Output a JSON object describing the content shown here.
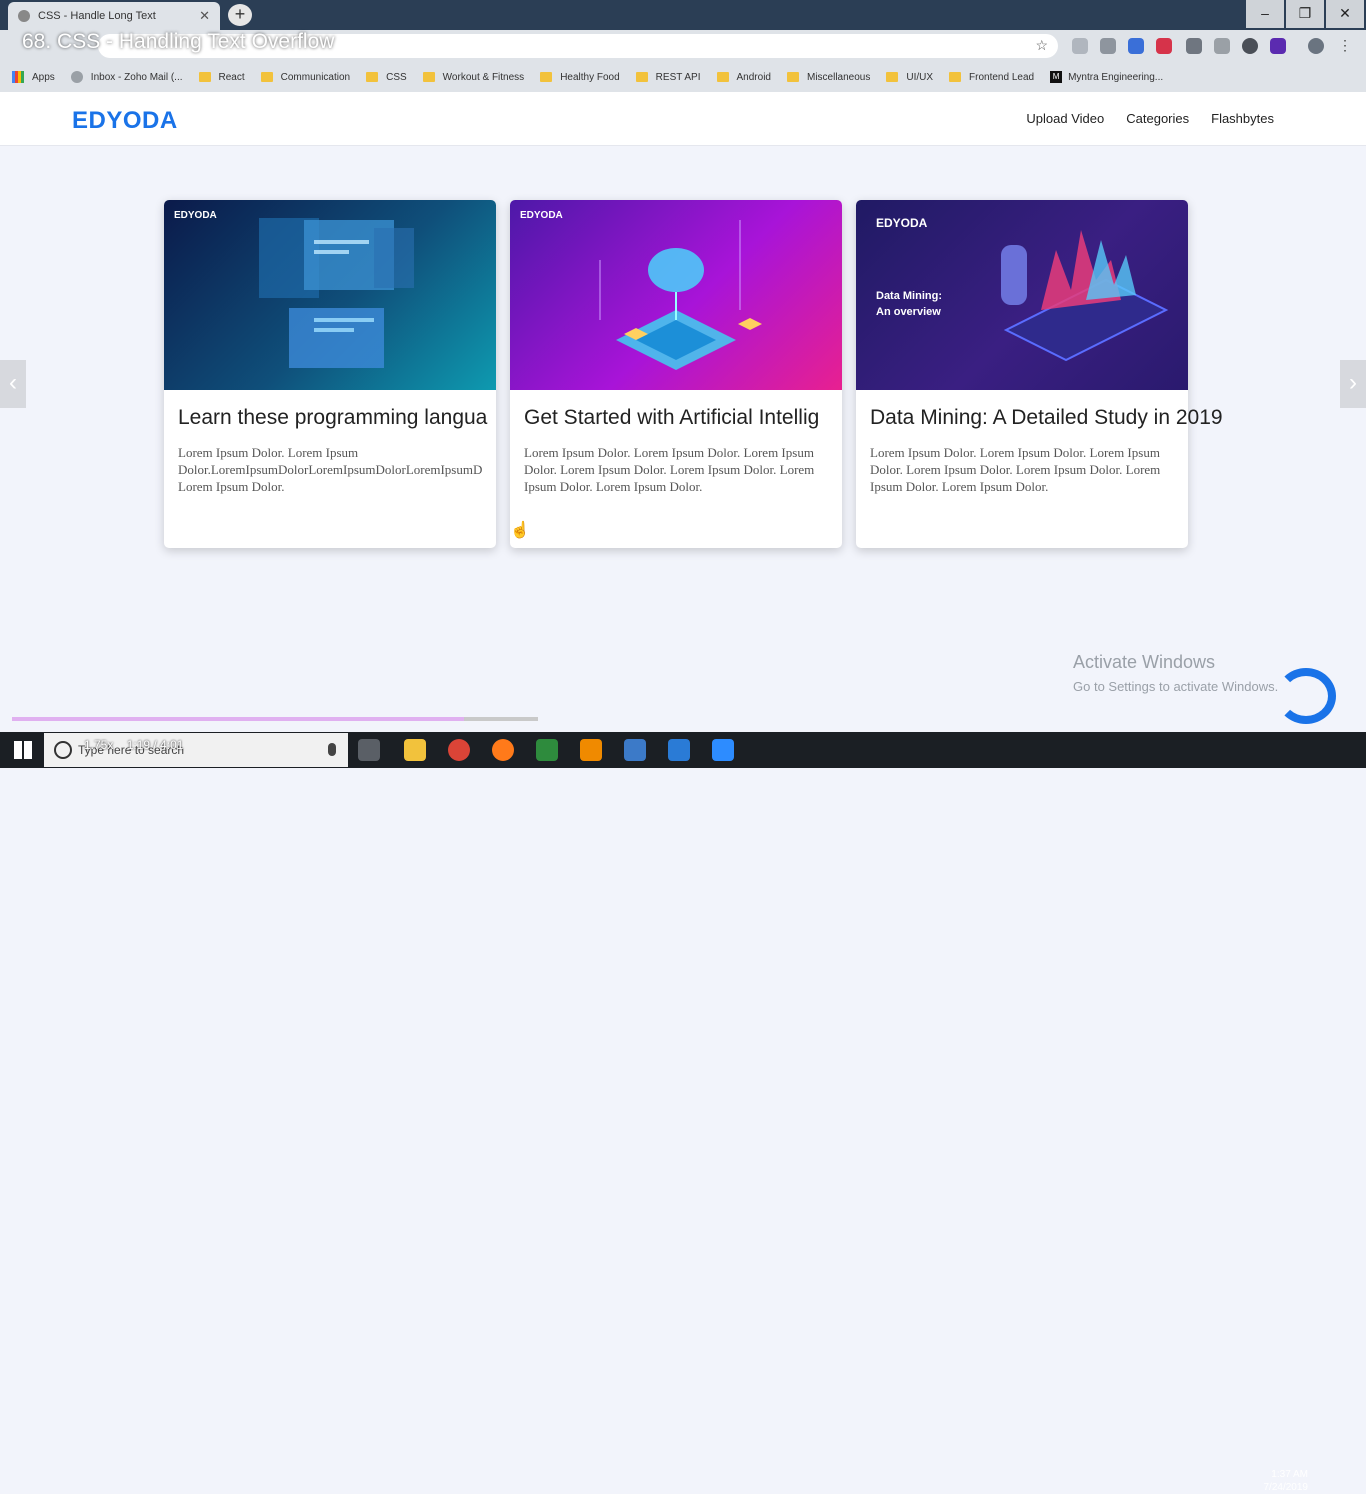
{
  "browser": {
    "tab_title": "CSS - Handle Long Text",
    "overlay_title": "68. CSS - Handling Text Overflow",
    "bookmarks": [
      "Apps",
      "Inbox - Zoho Mail (...",
      "React",
      "Communication",
      "CSS",
      "Workout & Fitness",
      "Healthy Food",
      "REST API",
      "Android",
      "Miscellaneous",
      "UI/UX",
      "Frontend Lead",
      "Myntra Engineering..."
    ]
  },
  "site": {
    "logo": "EDYODA",
    "nav": [
      "Upload Video",
      "Categories",
      "Flashbytes"
    ]
  },
  "cards": [
    {
      "brand": "EDYODA",
      "title": "Learn these programming langua",
      "body": "Lorem Ipsum Dolor. Lorem Ipsum Dolor.LoremIpsumDolorLoremIpsumDolorLoremIpsumD Lorem Ipsum Dolor."
    },
    {
      "brand": "EDYODA",
      "title": "Get Started with Artificial Intellig",
      "body": "Lorem Ipsum Dolor. Lorem Ipsum Dolor. Lorem Ipsum Dolor. Lorem Ipsum Dolor. Lorem Ipsum Dolor. Lorem Ipsum Dolor. Lorem Ipsum Dolor."
    },
    {
      "brand": "EDYODA",
      "thumb_caption_1": "Data Mining:",
      "thumb_caption_2": "An overview",
      "title": "Data Mining: A Detailed Study in 2019",
      "body": "Lorem Ipsum Dolor. Lorem Ipsum Dolor. Lorem Ipsum Dolor. Lorem Ipsum Dolor. Lorem Ipsum Dolor. Lorem Ipsum Dolor. Lorem Ipsum Dolor."
    }
  ],
  "windows_notice": {
    "line1": "Activate Windows",
    "line2": "Go to Settings to activate Windows."
  },
  "taskbar": {
    "search_placeholder": "Type here to search",
    "video_time": "1:19 / 4:01",
    "playback_speed": "1.75x",
    "clock_time": "1:37 AM",
    "clock_date": "7/24/2019"
  },
  "video_progress": 0.86
}
